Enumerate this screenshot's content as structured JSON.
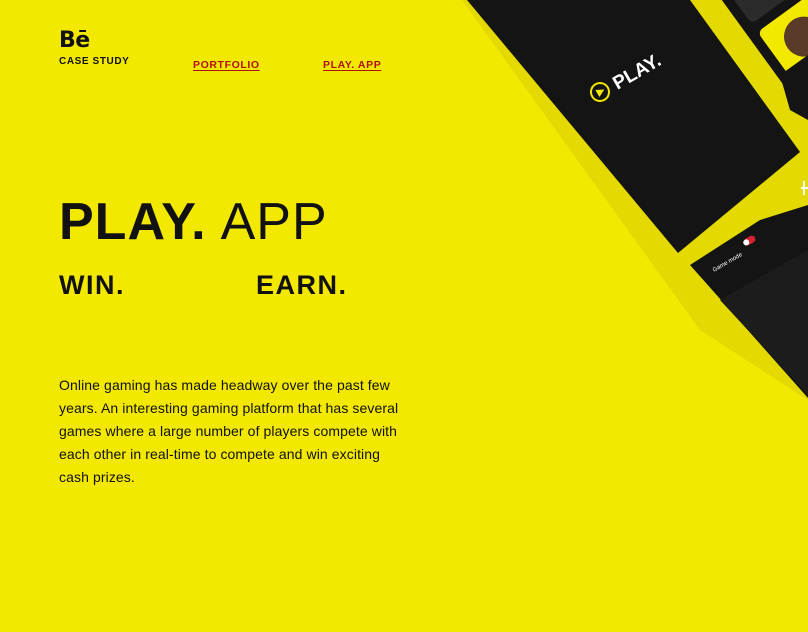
{
  "brand": {
    "logo_text": "Bē",
    "subtitle": "CASE STUDY"
  },
  "nav": {
    "portfolio_label": "PORTFOLIO",
    "play_app_label": "PLAY. APP"
  },
  "hero": {
    "title_strong": "PLAY.",
    "title_light": "APP",
    "tag_win": "WIN.",
    "tag_earn": "EARN."
  },
  "description": "Online gaming has made headway over the past few years. An interesting gaming platform that has several games where a large number of players compete with each other in real-time to compete and win exciting cash prizes.",
  "mockup": {
    "splash_logo_text": "PLAY.",
    "game_mode_label": "Game mode",
    "play_icon": "play-triangle-icon",
    "toggle_icon": "toggle-switch-icon"
  },
  "colors": {
    "background": "#f2e800",
    "text": "#111111",
    "link": "#b0120f",
    "device_dark": "#141414",
    "accent_yellow": "#f2e800",
    "toggle_red": "#d4232c"
  }
}
